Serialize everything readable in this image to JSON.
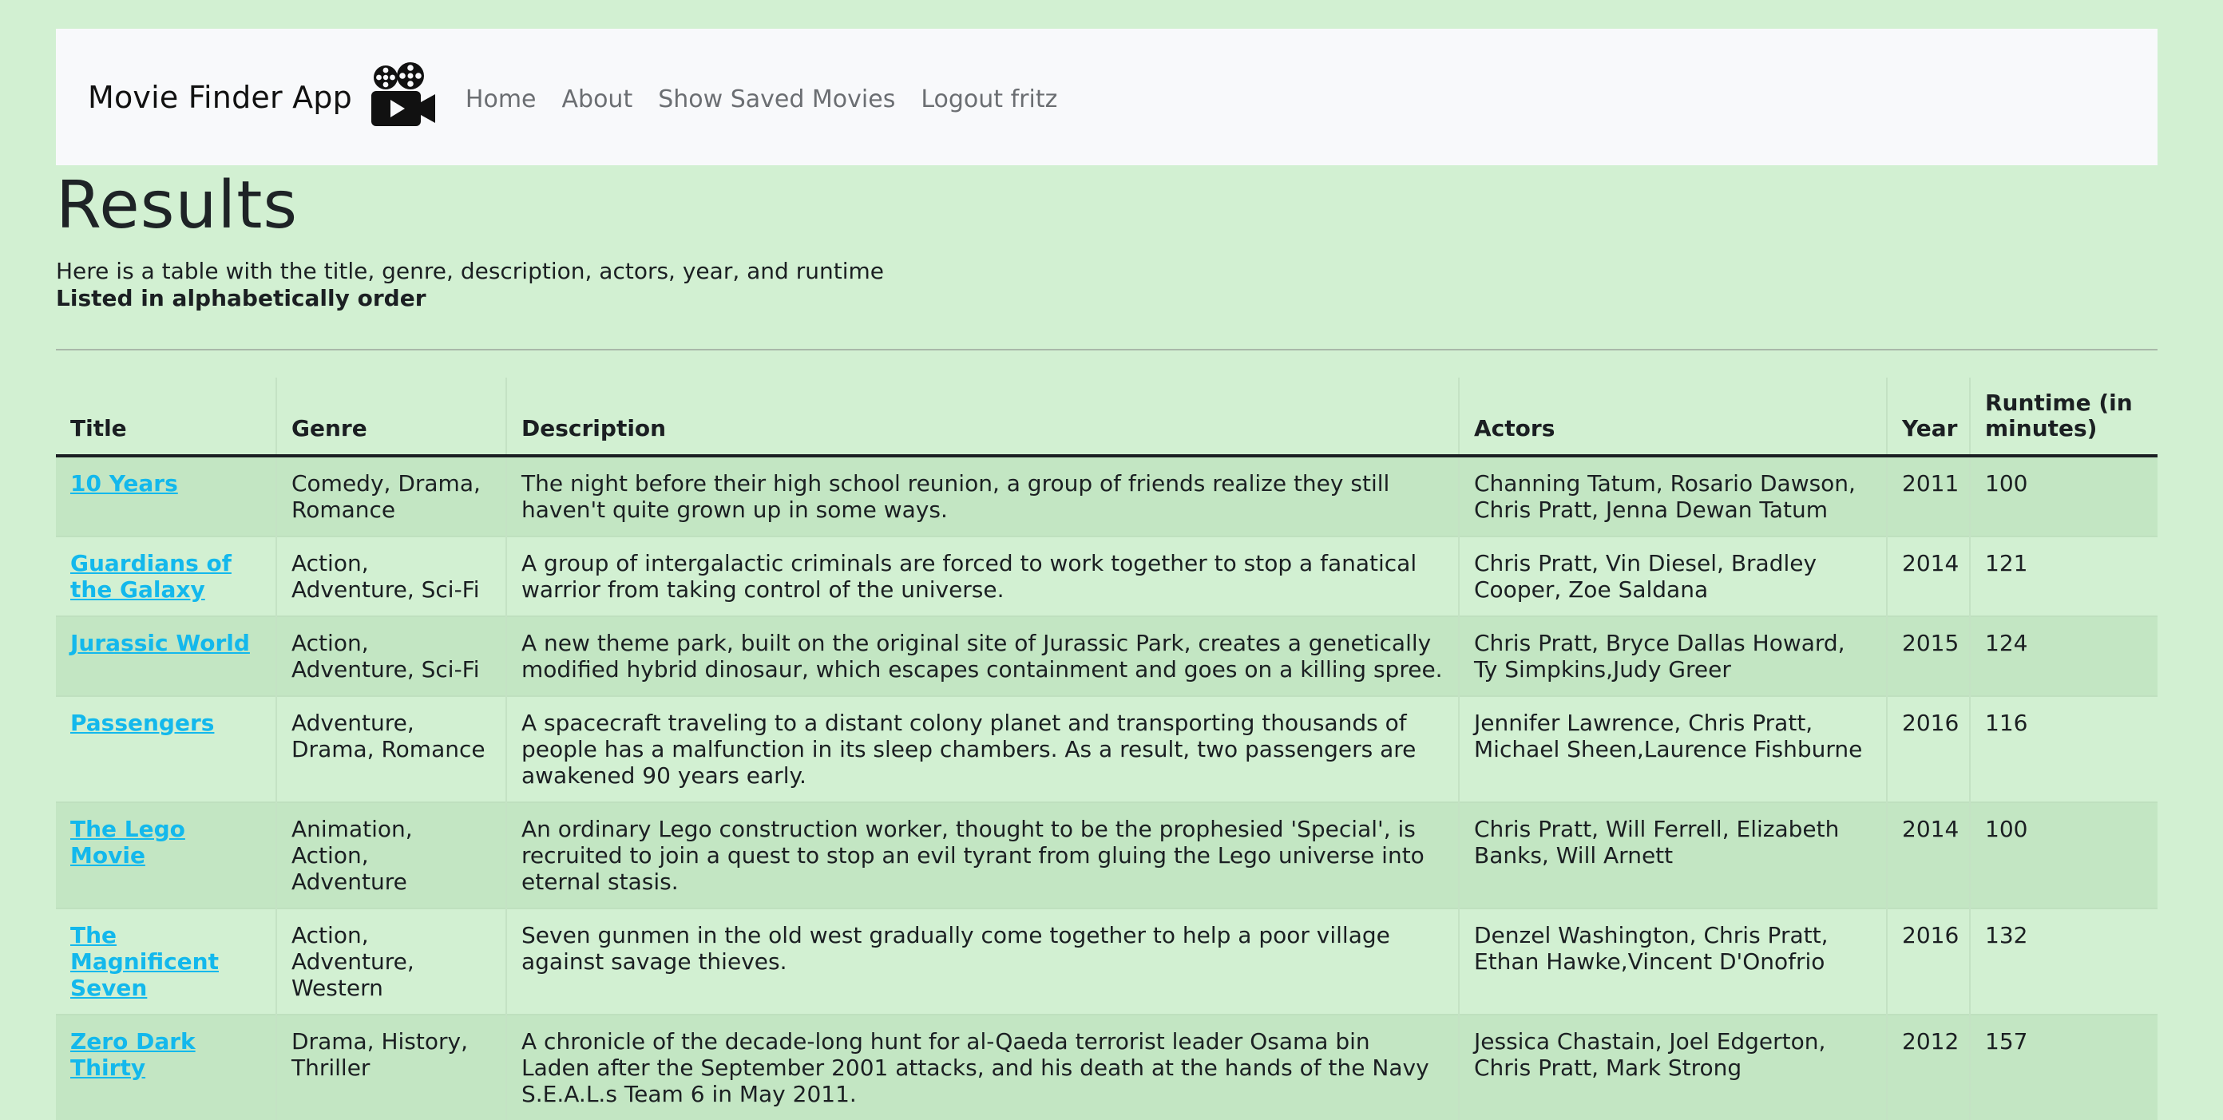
{
  "app": {
    "brand": "Movie Finder App",
    "brand_icon": "movie-camera-icon"
  },
  "nav": {
    "items": [
      {
        "label": "Home"
      },
      {
        "label": "About"
      },
      {
        "label": "Show Saved Movies"
      },
      {
        "label": "Logout fritz"
      }
    ]
  },
  "page": {
    "title": "Results",
    "intro_line1": "Here is a table with the title, genre, description, actors, year, and runtime",
    "intro_line2": "Listed in alphabetically order"
  },
  "table": {
    "headers": {
      "title": "Title",
      "genre": "Genre",
      "description": "Description",
      "actors": "Actors",
      "year": "Year",
      "runtime": "Runtime (in minutes)"
    },
    "rows": [
      {
        "title": "10 Years",
        "genre": "Comedy, Drama, Romance",
        "description": "The night before their high school reunion, a group of friends realize they still haven't quite grown up in some ways.",
        "actors": "Channing Tatum, Rosario Dawson, Chris Pratt, Jenna Dewan Tatum",
        "year": "2011",
        "runtime": "100"
      },
      {
        "title": "Guardians of the Galaxy",
        "genre": "Action, Adventure, Sci-Fi",
        "description": "A group of intergalactic criminals are forced to work together to stop a fanatical warrior from taking control of the universe.",
        "actors": "Chris Pratt, Vin Diesel, Bradley Cooper, Zoe Saldana",
        "year": "2014",
        "runtime": "121"
      },
      {
        "title": "Jurassic World",
        "genre": "Action, Adventure, Sci-Fi",
        "description": "A new theme park, built on the original site of Jurassic Park, creates a genetically modified hybrid dinosaur, which escapes containment and goes on a killing spree.",
        "actors": "Chris Pratt, Bryce Dallas Howard, Ty Simpkins,Judy Greer",
        "year": "2015",
        "runtime": "124"
      },
      {
        "title": "Passengers",
        "genre": "Adventure, Drama, Romance",
        "description": "A spacecraft traveling to a distant colony planet and transporting thousands of people has a malfunction in its sleep chambers. As a result, two passengers are awakened 90 years early.",
        "actors": "Jennifer Lawrence, Chris Pratt, Michael Sheen,Laurence Fishburne",
        "year": "2016",
        "runtime": "116"
      },
      {
        "title": "The Lego Movie",
        "genre": "Animation, Action, Adventure",
        "description": "An ordinary Lego construction worker, thought to be the prophesied 'Special', is recruited to join a quest to stop an evil tyrant from gluing the Lego universe into eternal stasis.",
        "actors": "Chris Pratt, Will Ferrell, Elizabeth Banks, Will Arnett",
        "year": "2014",
        "runtime": "100"
      },
      {
        "title": "The Magnificent Seven",
        "genre": "Action, Adventure, Western",
        "description": "Seven gunmen in the old west gradually come together to help a poor village against savage thieves.",
        "actors": "Denzel Washington, Chris Pratt, Ethan Hawke,Vincent D'Onofrio",
        "year": "2016",
        "runtime": "132"
      },
      {
        "title": "Zero Dark Thirty",
        "genre": "Drama, History, Thriller",
        "description": "A chronicle of the decade-long hunt for al-Qaeda terrorist leader Osama bin Laden after the September 2001 attacks, and his death at the hands of the Navy S.E.A.L.s Team 6 in May 2011.",
        "actors": "Jessica Chastain, Joel Edgerton, Chris Pratt, Mark Strong",
        "year": "2012",
        "runtime": "157"
      }
    ]
  }
}
